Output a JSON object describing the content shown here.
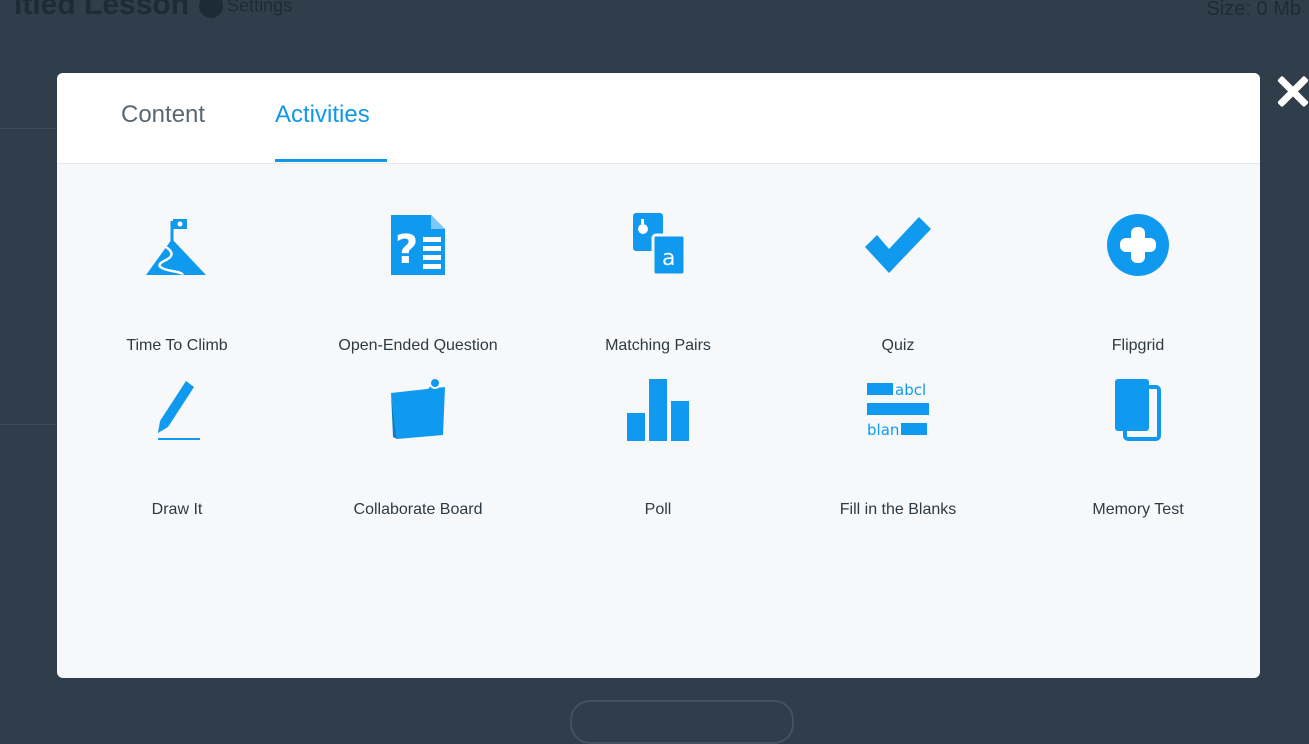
{
  "background": {
    "title": "itled Lesson",
    "settings_label": "Settings",
    "size_label": "Size: 0 Mb"
  },
  "modal": {
    "tabs": [
      {
        "label": "Content",
        "active": false
      },
      {
        "label": "Activities",
        "active": true
      }
    ],
    "activities": [
      {
        "label": "Time To Climb",
        "icon": "mountain-flag-icon"
      },
      {
        "label": "Open-Ended Question",
        "icon": "question-document-icon"
      },
      {
        "label": "Matching Pairs",
        "icon": "matching-cards-icon"
      },
      {
        "label": "Quiz",
        "icon": "checkmark-icon"
      },
      {
        "label": "Flipgrid",
        "icon": "plus-circle-icon"
      },
      {
        "label": "Draw It",
        "icon": "pencil-icon"
      },
      {
        "label": "Collaborate Board",
        "icon": "pinned-note-icon"
      },
      {
        "label": "Poll",
        "icon": "bar-chart-icon"
      },
      {
        "label": "Fill in the Blanks",
        "icon": "fill-blanks-icon",
        "glyph_text": [
          "abcl",
          "blan"
        ]
      },
      {
        "label": "Memory Test",
        "icon": "memory-cards-icon"
      }
    ]
  },
  "colors": {
    "accent": "#1197e8",
    "icon_blue": "#0f9af0",
    "overlay": "#2f3e4a"
  }
}
